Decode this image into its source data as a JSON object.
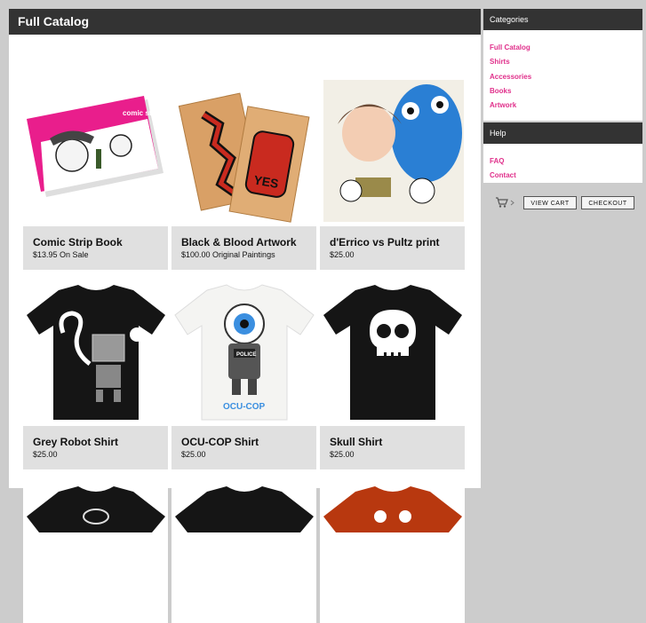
{
  "main": {
    "title": "Full Catalog"
  },
  "products": [
    {
      "name": "Comic Strip Book",
      "price": "$13.95 On Sale",
      "thumb_label": "comic strip"
    },
    {
      "name": "Black & Blood Artwork",
      "price": "$100.00 Original Paintings",
      "thumb_label": "YES"
    },
    {
      "name": "d'Errico vs Pultz print",
      "price": "$25.00",
      "thumb_label": ""
    },
    {
      "name": "Grey Robot Shirt",
      "price": "$25.00",
      "thumb_label": ""
    },
    {
      "name": "OCU-COP Shirt",
      "price": "$25.00",
      "thumb_label": "OCU-COP",
      "badge_label": "POLICE"
    },
    {
      "name": "Skull Shirt",
      "price": "$25.00",
      "thumb_label": ""
    }
  ],
  "sidebar": {
    "categories": {
      "title": "Categories",
      "items": [
        "Full Catalog",
        "Shirts",
        "Accessories",
        "Books",
        "Artwork"
      ]
    },
    "help": {
      "title": "Help",
      "items": [
        "FAQ",
        "Contact"
      ]
    },
    "cart": {
      "view_label": "VIEW CART",
      "checkout_label": "CHECKOUT"
    }
  },
  "colors": {
    "accent_link": "#e0308b",
    "header_bg": "#333333",
    "info_bg": "#e0e0e0"
  }
}
